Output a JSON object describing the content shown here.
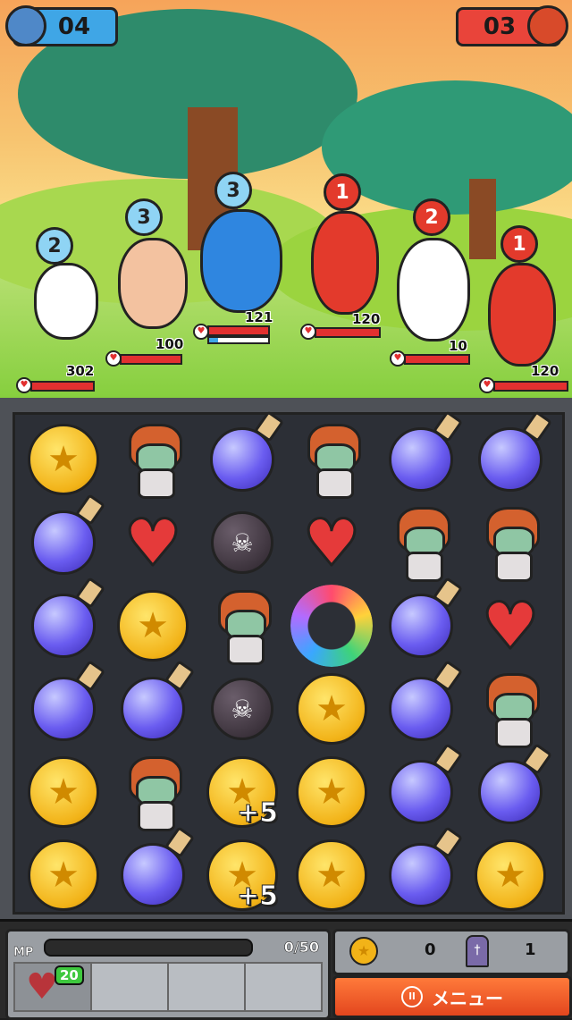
{
  "top_bar": {
    "player_score": "04",
    "enemy_score": "03"
  },
  "player_units": [
    {
      "turns": "2",
      "hp": "302",
      "colors": {
        "body": "#ffffff"
      }
    },
    {
      "turns": "3",
      "hp": "100",
      "colors": {
        "body": "#f3c2a0"
      }
    },
    {
      "turns": "3",
      "hp": "121",
      "colors": {
        "body": "#2f86e0"
      }
    }
  ],
  "enemy_units": [
    {
      "turns": "1",
      "hp": "120",
      "colors": {
        "body": "#e33a2c"
      }
    },
    {
      "turns": "2",
      "hp": "10",
      "colors": {
        "body": "#ffffff"
      }
    },
    {
      "turns": "1",
      "hp": "120",
      "colors": {
        "body": "#e33a2c"
      }
    }
  ],
  "board": {
    "rows": [
      [
        "coin",
        "zombie",
        "potion",
        "zombie",
        "potion",
        "potion"
      ],
      [
        "potion",
        "heart",
        "bomb",
        "heart",
        "zombie",
        "zombie"
      ],
      [
        "potion",
        "coin",
        "zombie",
        "refresh",
        "potion",
        "heart"
      ],
      [
        "potion",
        "potion",
        "bomb",
        "coin",
        "potion",
        "zombie"
      ],
      [
        "coin",
        "zombie",
        "coin",
        "coin",
        "potion",
        "potion"
      ],
      [
        "coin",
        "potion",
        "coin",
        "coin",
        "potion",
        "coin"
      ]
    ],
    "bonus_labels": [
      "+5",
      "+5"
    ]
  },
  "hud": {
    "mp_label": "MP",
    "mp_value": "0/50",
    "heart_count": "20",
    "coins": "0",
    "tombstones": "1",
    "menu_label": "メニュー",
    "menu_icon": "pause-icon"
  }
}
